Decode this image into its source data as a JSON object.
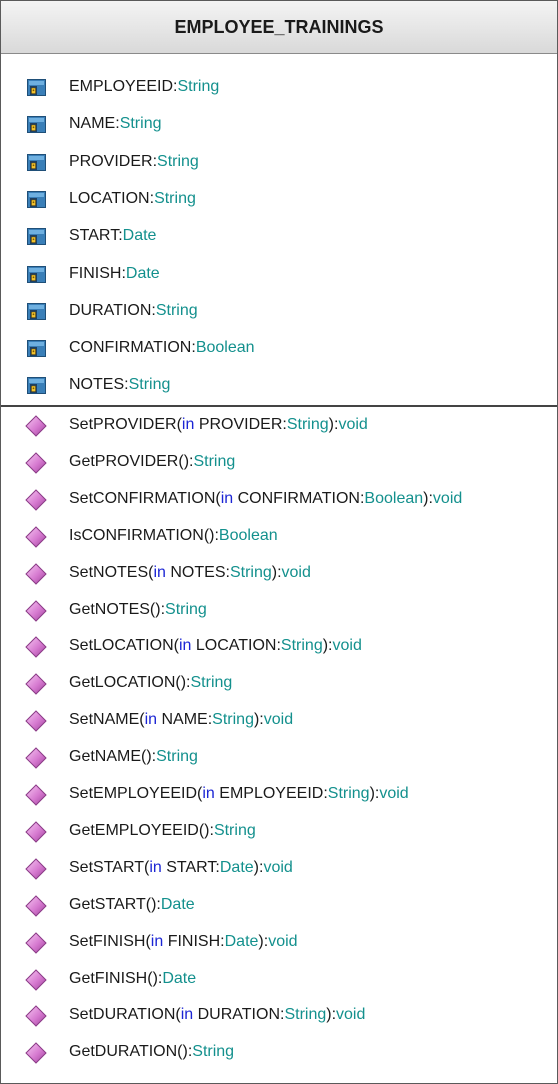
{
  "class": {
    "name": "EMPLOYEE_TRAININGS",
    "keyword_in": "in",
    "attributes": [
      {
        "name": "EMPLOYEEID",
        "type": "String"
      },
      {
        "name": "NAME",
        "type": "String"
      },
      {
        "name": "PROVIDER",
        "type": "String"
      },
      {
        "name": "LOCATION",
        "type": "String"
      },
      {
        "name": "START",
        "type": "Date"
      },
      {
        "name": "FINISH",
        "type": "Date"
      },
      {
        "name": "DURATION",
        "type": "String"
      },
      {
        "name": "CONFIRMATION",
        "type": "Boolean"
      },
      {
        "name": "NOTES",
        "type": "String"
      }
    ],
    "operations": [
      {
        "name": "SetPROVIDER",
        "param": "PROVIDER",
        "param_type": "String",
        "ret": "void"
      },
      {
        "name": "GetPROVIDER",
        "ret": "String"
      },
      {
        "name": "SetCONFIRMATION",
        "param": "CONFIRMATION",
        "param_type": "Boolean",
        "ret": "void"
      },
      {
        "name": "IsCONFIRMATION",
        "ret": "Boolean"
      },
      {
        "name": "SetNOTES",
        "param": "NOTES",
        "param_type": "String",
        "ret": "void"
      },
      {
        "name": "GetNOTES",
        "ret": "String"
      },
      {
        "name": "SetLOCATION",
        "param": "LOCATION",
        "param_type": "String",
        "ret": "void"
      },
      {
        "name": "GetLOCATION",
        "ret": "String"
      },
      {
        "name": "SetNAME",
        "param": "NAME",
        "param_type": "String",
        "ret": "void"
      },
      {
        "name": "GetNAME",
        "ret": "String"
      },
      {
        "name": "SetEMPLOYEEID",
        "param": "EMPLOYEEID",
        "param_type": "String",
        "ret": "void"
      },
      {
        "name": "GetEMPLOYEEID",
        "ret": "String"
      },
      {
        "name": "SetSTART",
        "param": "START",
        "param_type": "Date",
        "ret": "void"
      },
      {
        "name": "GetSTART",
        "ret": "Date"
      },
      {
        "name": "SetFINISH",
        "param": "FINISH",
        "param_type": "Date",
        "ret": "void"
      },
      {
        "name": "GetFINISH",
        "ret": "Date"
      },
      {
        "name": "SetDURATION",
        "param": "DURATION",
        "param_type": "String",
        "ret": "void"
      },
      {
        "name": "GetDURATION",
        "ret": "String"
      }
    ],
    "icons": {
      "attribute": "private-field-icon",
      "operation": "public-method-icon"
    }
  }
}
